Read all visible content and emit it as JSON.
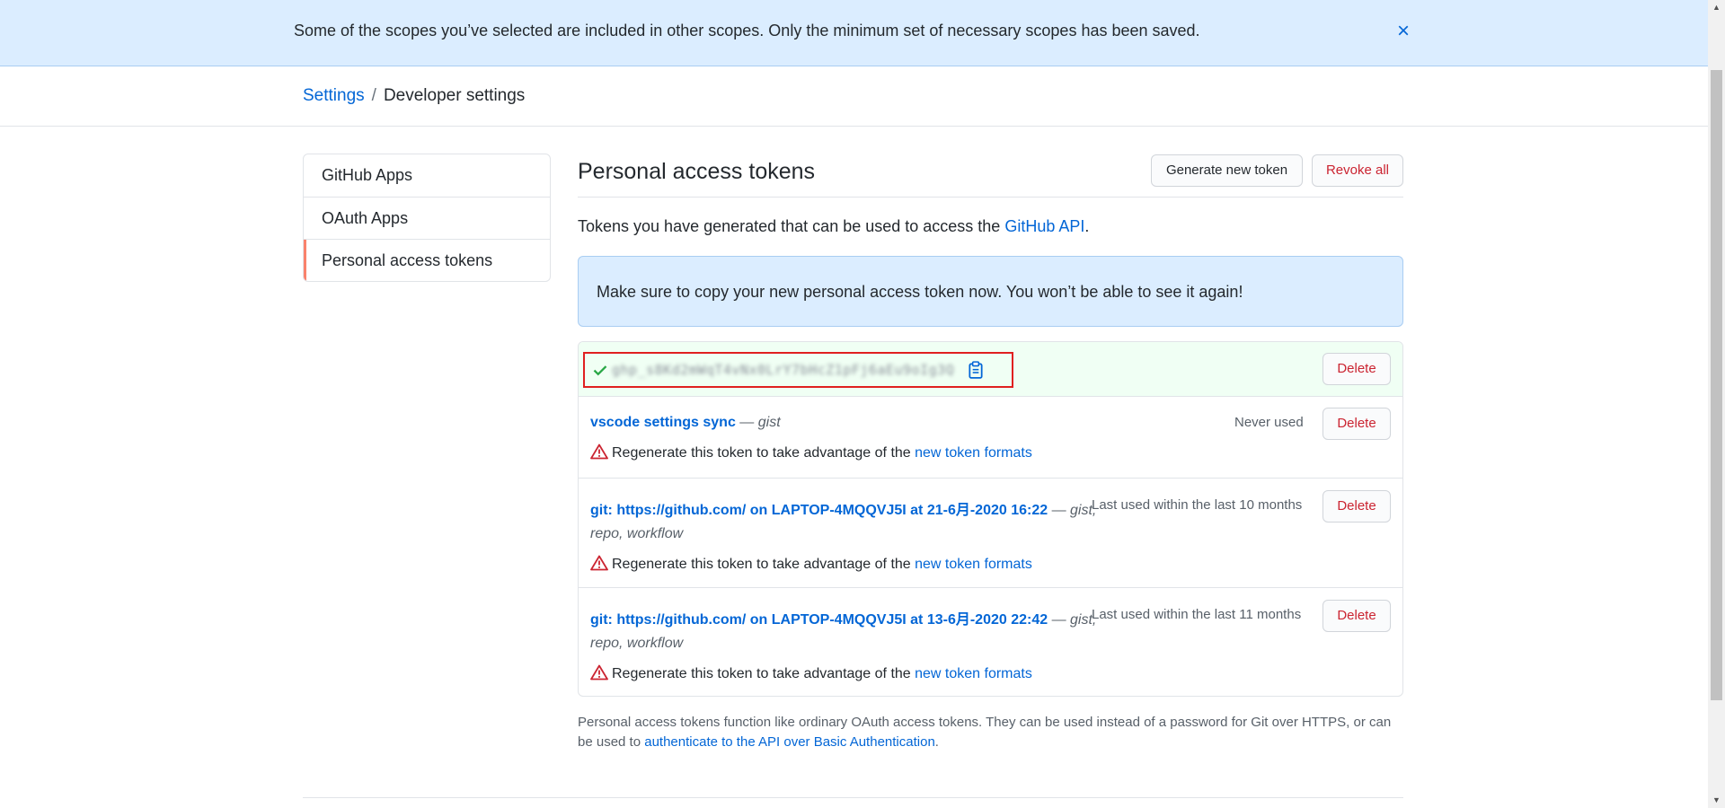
{
  "flash": {
    "message": "Some of the scopes you’ve selected are included in other scopes. Only the minimum set of necessary scopes has been saved.",
    "close_label": "×"
  },
  "breadcrumb": {
    "settings": "Settings",
    "separator": "/",
    "current": "Developer settings"
  },
  "sidebar": {
    "items": [
      {
        "label": "GitHub Apps"
      },
      {
        "label": "OAuth Apps"
      },
      {
        "label": "Personal access tokens"
      }
    ]
  },
  "main": {
    "title": "Personal access tokens",
    "generate_label": "Generate new token",
    "revoke_label": "Revoke all",
    "intro_prefix": "Tokens you have generated that can be used to access the ",
    "intro_link": "GitHub API",
    "intro_suffix": ".",
    "notice": "Make sure to copy your new personal access token now. You won’t be able to see it again!"
  },
  "new_token": {
    "value": "ghp_s8Kd2mWqT4vNx0LrY7bHcZ1pFj6aEu9oIg3Q",
    "delete_label": "Delete"
  },
  "tokens": [
    {
      "name": "vscode settings sync",
      "dash": " — ",
      "scopes": "gist",
      "scopes_line2": "",
      "last_used": "Never used",
      "warning_text": "Regenerate this token to take advantage of the ",
      "warning_link": "new token formats",
      "delete_label": "Delete"
    },
    {
      "name": "git: https://github.com/ on LAPTOP-4MQQVJ5I at 21-6月-2020 16:22",
      "dash": " — ",
      "scopes": "gist,",
      "scopes_line2": "repo, workflow",
      "last_used": "Last used within the last 10 months",
      "warning_text": "Regenerate this token to take advantage of the ",
      "warning_link": "new token formats",
      "delete_label": "Delete"
    },
    {
      "name": "git: https://github.com/ on LAPTOP-4MQQVJ5I at 13-6月-2020 22:42",
      "dash": " — ",
      "scopes": "gist,",
      "scopes_line2": "repo, workflow",
      "last_used": "Last used within the last 11 months",
      "warning_text": "Regenerate this token to take advantage of the ",
      "warning_link": "new token formats",
      "delete_label": "Delete"
    }
  ],
  "footnote": {
    "text": "Personal access tokens function like ordinary OAuth access tokens. They can be used instead of a password for Git over HTTPS, or can be used to ",
    "link": "authenticate to the API over Basic Authentication",
    "suffix": "."
  },
  "colors": {
    "link": "#0366d6",
    "danger": "#cb2431",
    "flash_bg": "#dbedff",
    "success_bg": "#f0fff4",
    "selected_marker": "#f9826c",
    "highlight_box": "#e02020"
  },
  "icons": {
    "close": "x-icon",
    "check": "check-icon",
    "copy": "clipboard-icon",
    "warning": "alert-icon"
  }
}
